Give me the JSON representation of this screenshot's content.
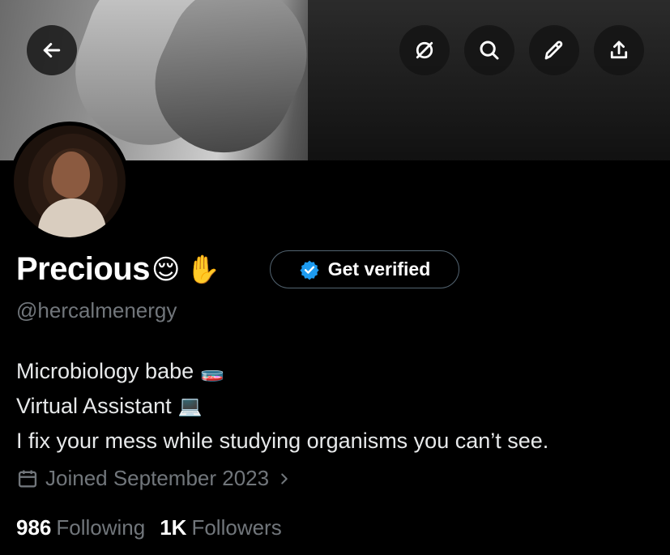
{
  "profile": {
    "name": "Precious",
    "name_emojis": [
      "😌",
      "✋"
    ],
    "handle": "@hercalmenergy",
    "verify_label": "Get verified",
    "bio": {
      "line1": "Microbiology babe",
      "line1_emoji": "🧫",
      "line2": "Virtual Assistant",
      "line2_emoji": "💻",
      "line3": "I fix your mess while studying organisms you can’t see."
    },
    "joined": "Joined September 2023",
    "following_count": "986",
    "following_label": "Following",
    "followers_count": "1K",
    "followers_label": "Followers"
  },
  "icons": {
    "back": "arrow-left-icon",
    "grok": "slash-circle-icon",
    "search": "search-icon",
    "edit": "pencil-icon",
    "share": "share-icon",
    "calendar": "calendar-icon",
    "chevron": "chevron-right-icon",
    "badge": "verified-badge-icon"
  },
  "colors": {
    "background": "#000000",
    "text_primary": "#e7e9ea",
    "text_secondary": "#71767b",
    "verified_blue": "#1d9bf0",
    "button_border": "#536471"
  }
}
